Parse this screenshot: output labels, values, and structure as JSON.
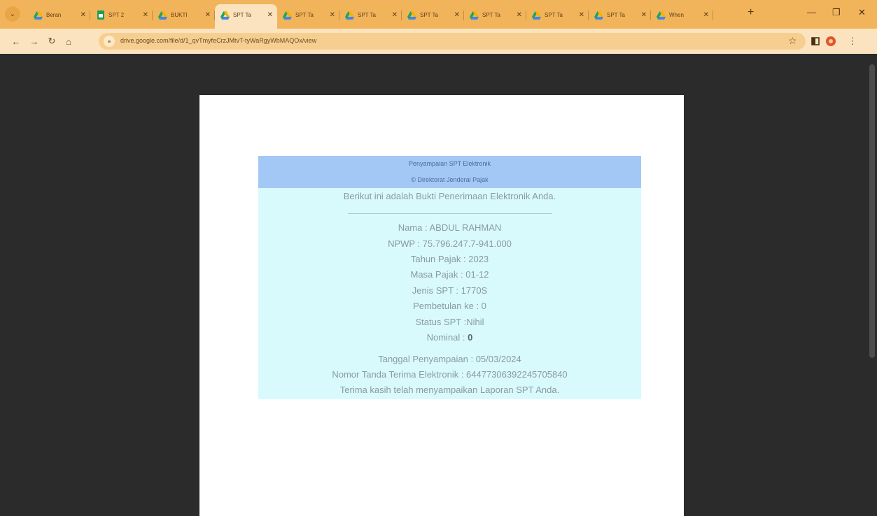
{
  "browser": {
    "tabs": [
      {
        "label": "Beran",
        "icon": "google-drive-icon"
      },
      {
        "label": "SPT 2",
        "icon": "google-sheets-icon"
      },
      {
        "label": "BUKTI",
        "icon": "google-drive-icon"
      },
      {
        "label": "SPT Ta",
        "icon": "google-drive-icon",
        "active": true
      },
      {
        "label": "SPT Ta",
        "icon": "google-drive-icon"
      },
      {
        "label": "SPT Ta",
        "icon": "google-drive-icon"
      },
      {
        "label": "SPT Ta",
        "icon": "google-drive-icon"
      },
      {
        "label": "SPT Ta",
        "icon": "google-drive-icon"
      },
      {
        "label": "SPT Ta",
        "icon": "google-drive-icon"
      },
      {
        "label": "SPT Ta",
        "icon": "google-drive-icon"
      },
      {
        "label": "When",
        "icon": "google-drive-icon"
      }
    ],
    "url": "drive.google.com/file/d/1_qvTmyfeCrzJMtvT-tyWaRgyWbMAQOx/view",
    "colors": {
      "frame": "#f2b45a",
      "toolbar": "#fbe3bf",
      "profile": "#e0542e"
    }
  },
  "receipt": {
    "header_line1": "Penyampaian SPT Elektronik",
    "header_line2": "© Direktorat Jenderal Pajak",
    "intro": "Berikut ini adalah Bukti Penerimaan Elektronik Anda.",
    "nama": "Nama : ABDUL RAHMAN",
    "npwp": "NPWP : 75.796.247.7-941.000",
    "tahun_pajak": "Tahun Pajak : 2023",
    "masa_pajak": "Masa Pajak : 01-12",
    "jenis_spt": "Jenis SPT : 1770S",
    "pembetulan": "Pembetulan ke : 0",
    "status_spt": "Status SPT :Nihil",
    "nominal_label": "Nominal : ",
    "nominal_value": "0",
    "tanggal": "Tanggal Penyampaian : 05/03/2024",
    "nomor_tanda_terima": "Nomor Tanda Terima Elektronik : 644773063922457058​40",
    "closing": "Terima kasih telah menyampaikan Laporan SPT Anda.",
    "colors": {
      "header_bg": "#a4c8f5",
      "body_bg": "#d8fafd"
    }
  }
}
